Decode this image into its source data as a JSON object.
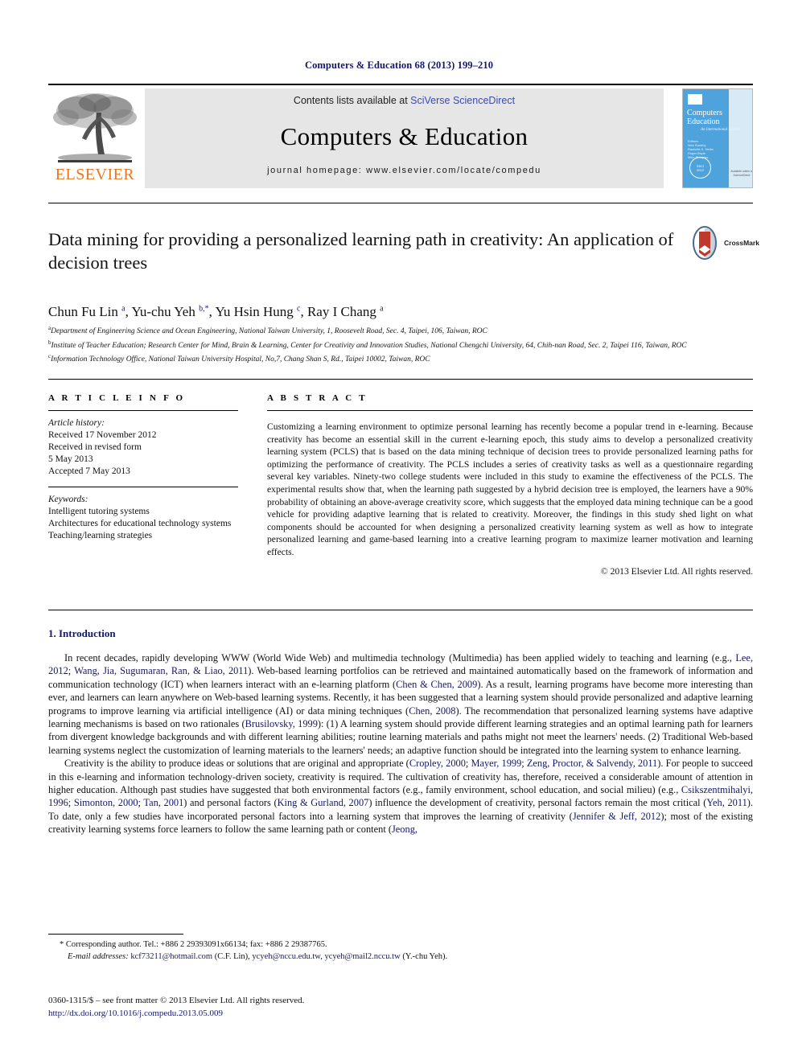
{
  "running_head": "Computers & Education 68 (2013) 199–210",
  "journal_header": {
    "contents_prefix": "Contents lists available at ",
    "contents_link": "SciVerse ScienceDirect",
    "journal_title": "Computers & Education",
    "homepage_line": "journal homepage: www.elsevier.com/locate/compedu",
    "publisher_logo_text": "ELSEVIER",
    "cover": {
      "title_line1": "Computers",
      "amp": "&",
      "title_line2": "Education",
      "subtitle": "An International Journal",
      "editors": "Editors:\nNick Rushby\nRachelle S. Heller\nRoger Boyle\nMike Sharples",
      "seal_text": "SSCI\n2012",
      "footer": "Available online at\nScienceDirect"
    }
  },
  "article": {
    "title": "Data mining for providing a personalized learning path in creativity: An application of decision trees",
    "crossmark_label": "CrossMark",
    "authors_html": "Chun Fu Lin <sup>a</sup>, Yu-chu Yeh <sup>b,</sup><sup>*</sup>, Yu Hsin Hung <sup>c</sup>, Ray I Chang <sup>a</sup>",
    "affiliations": [
      {
        "marker": "a",
        "text": "Department of Engineering Science and Ocean Engineering, National Taiwan University, 1, Roosevelt Road, Sec. 4, Taipei, 106, Taiwan, ROC"
      },
      {
        "marker": "b",
        "text": "Institute of Teacher Education; Research Center for Mind, Brain & Learning, Center for Creativity and Innovation Studies, National Chengchi University, 64, Chih-nan Road, Sec. 2, Taipei 116, Taiwan, ROC"
      },
      {
        "marker": "c",
        "text": "Information Technology Office, National Taiwan University Hospital, No,7, Chang Shan S, Rd., Taipei 10002, Taiwan, ROC"
      }
    ]
  },
  "article_info": {
    "heading": "A R T I C L E   I N F O",
    "history_label": "Article history:",
    "history_lines": [
      "Received 17 November 2012",
      "Received in revised form",
      "5 May 2013",
      "Accepted 7 May 2013"
    ],
    "keywords_label": "Keywords:",
    "keywords": [
      "Intelligent tutoring systems",
      "Architectures for educational technology systems",
      "Teaching/learning strategies"
    ]
  },
  "abstract": {
    "heading": "A B S T R A C T",
    "text": "Customizing a learning environment to optimize personal learning has recently become a popular trend in e-learning. Because creativity has become an essential skill in the current e-learning epoch, this study aims to develop a personalized creativity learning system (PCLS) that is based on the data mining technique of decision trees to provide personalized learning paths for optimizing the performance of creativity. The PCLS includes a series of creativity tasks as well as a questionnaire regarding several key variables. Ninety-two college students were included in this study to examine the effectiveness of the PCLS. The experimental results show that, when the learning path suggested by a hybrid decision tree is employed, the learners have a 90% probability of obtaining an above-average creativity score, which suggests that the employed data mining technique can be a good vehicle for providing adaptive learning that is related to creativity. Moreover, the findings in this study shed light on what components should be accounted for when designing a personalized creativity learning system as well as how to integrate personalized learning and game-based learning into a creative learning program to maximize learner motivation and learning effects.",
    "copyright": "© 2013 Elsevier Ltd. All rights reserved."
  },
  "introduction": {
    "heading": "1. Introduction",
    "paragraph1_html": "In recent decades, rapidly developing WWW (World Wide Web) and multimedia technology (Multimedia) has been applied widely to teaching and learning (e.g., <span class=\"ref\">Lee, 2012</span>; <span class=\"ref\">Wang, Jia, Sugumaran, Ran, &amp; Liao, 2011</span>). Web-based learning portfolios can be retrieved and maintained automatically based on the framework of information and communication technology (ICT) when learners interact with an e-learning platform (<span class=\"ref\">Chen &amp; Chen, 2009</span>). As a result, learning programs have become more interesting than ever, and learners can learn anywhere on Web-based learning systems. Recently, it has been suggested that a learning system should provide personalized and adaptive learning programs to improve learning via artificial intelligence (AI) or data mining techniques (<span class=\"ref\">Chen, 2008</span>). The recommendation that personalized learning systems have adaptive learning mechanisms is based on two rationales (<span class=\"ref\">Brusilovsky, 1999</span>): (1) A learning system should provide different learning strategies and an optimal learning path for learners from divergent knowledge backgrounds and with different learning abilities; routine learning materials and paths might not meet the learners' needs. (2) Traditional Web-based learning systems neglect the customization of learning materials to the learners' needs; an adaptive function should be integrated into the learning system to enhance learning.",
    "paragraph2_html": "Creativity is the ability to produce ideas or solutions that are original and appropriate (<span class=\"ref\">Cropley, 2000</span>; <span class=\"ref\">Mayer, 1999</span>; <span class=\"ref\">Zeng, Proctor, &amp; Salvendy, 2011</span>). For people to succeed in this e-learning and information technology-driven society, creativity is required. The cultivation of creativity has, therefore, received a considerable amount of attention in higher education. Although past studies have suggested that both environmental factors (e.g., family environment, school education, and social milieu) (e.g., <span class=\"ref\">Csikszentmihalyi, 1996</span>; <span class=\"ref\">Simonton, 2000</span>; <span class=\"ref\">Tan, 2001</span>) and personal factors (<span class=\"ref\">King &amp; Gurland, 2007</span>) influence the development of creativity, personal factors remain the most critical (<span class=\"ref\">Yeh, 2011</span>). To date, only a few studies have incorporated personal factors into a learning system that improves the learning of creativity (<span class=\"ref\">Jennifer &amp; Jeff, 2012</span>); most of the existing creativity learning systems force learners to follow the same learning path or content (<span class=\"ref\">Jeong,</span>"
  },
  "footnotes": {
    "corresponding_html": "* Corresponding author. Tel.: +886 2 29393091x66134; fax: +886 2 29387765.",
    "email_html": "<span class=\"ital\">E-mail addresses:</span> <span class=\"lnk\">kcf73211@hotmail.com</span> (C.F. Lin), <span class=\"lnk\">ycyeh@nccu.edu.tw</span>, <span class=\"lnk\">ycyeh@mail2.nccu.tw</span> (Y.-chu Yeh)."
  },
  "imprint": {
    "line1": "0360-1315/$ – see front matter © 2013 Elsevier Ltd. All rights reserved.",
    "doi": "http://dx.doi.org/10.1016/j.compedu.2013.05.009"
  },
  "colors": {
    "link_blue": "#14186b",
    "sciencedirect_blue": "#3b4ba8",
    "elsevier_orange": "#e87722",
    "masthead_gray": "#e6e6e6",
    "cover_blue": "#4fa3dd",
    "crossmark_red": "#c0392b"
  }
}
